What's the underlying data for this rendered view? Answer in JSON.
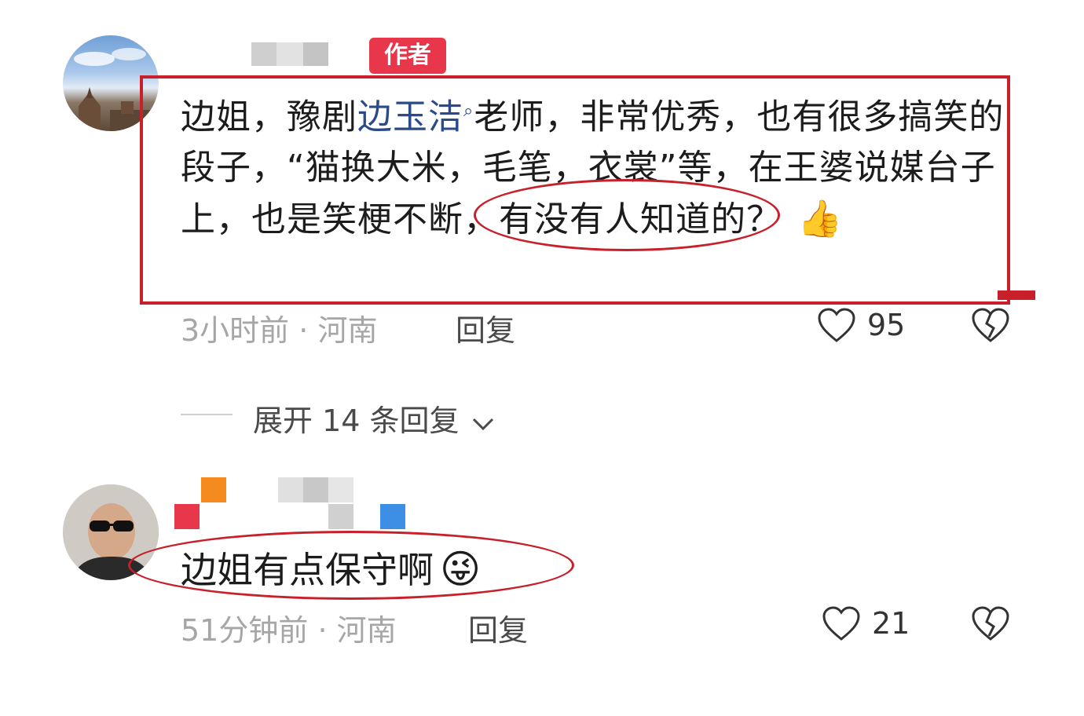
{
  "comments": [
    {
      "badge": "作者",
      "text_before": "边姐，豫剧",
      "link_text": "边玉洁",
      "text_after": "老师，非常优秀，也有很多搞笑的段子，“猫换大米，毛笔，衣裳”等，在王婆说媒台子上，也是笑梗不断，有没有人知道的？",
      "emoji": "👍",
      "time": "3小时前",
      "sep": "·",
      "location": "河南",
      "reply": "回复",
      "likes": "95"
    },
    {
      "text": "边姐有点保守啊",
      "emoji": "😜",
      "time": "51分钟前",
      "sep": "·",
      "location": "河南",
      "reply": "回复",
      "likes": "21"
    }
  ],
  "expand_replies": "展开 14 条回复",
  "icons": {
    "like": "heart-icon",
    "dislike": "broken-heart-icon",
    "search": "search-icon",
    "expand": "chevron-down-icon"
  },
  "colors": {
    "highlight": "#c8202a",
    "badge": "#e8374a",
    "link": "#2a4a8a"
  }
}
